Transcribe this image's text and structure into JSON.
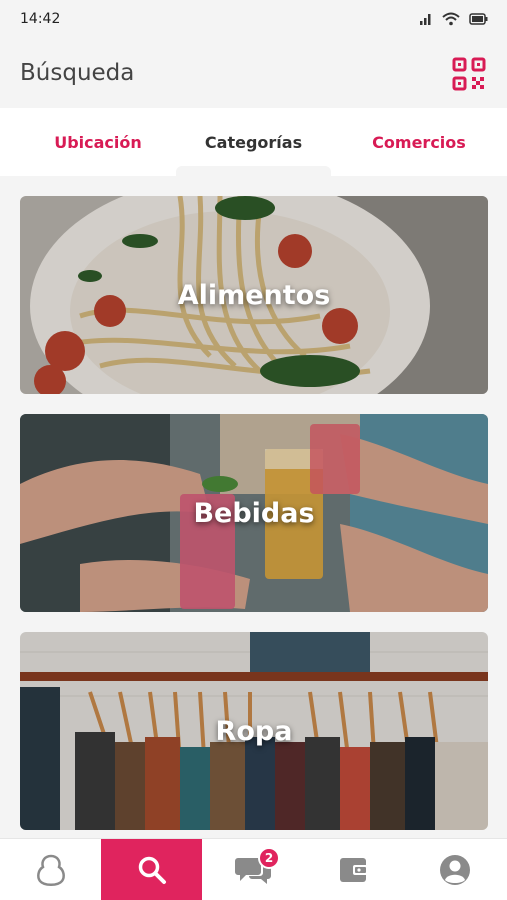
{
  "status_bar": {
    "time": "14:42"
  },
  "header": {
    "title": "Búsqueda",
    "qr_icon": "qr-code-icon"
  },
  "tabs": [
    {
      "label": "Ubicación",
      "active": false
    },
    {
      "label": "Categorías",
      "active": true
    },
    {
      "label": "Comercios",
      "active": false
    }
  ],
  "categories": [
    {
      "label": "Alimentos",
      "image": "pasta-dish-photo"
    },
    {
      "label": "Bebidas",
      "image": "drinks-toast-photo"
    },
    {
      "label": "Ropa",
      "image": "clothes-rack-photo"
    }
  ],
  "bottom_nav": {
    "items": [
      {
        "icon": "home-logo-icon"
      },
      {
        "icon": "search-icon",
        "active": true
      },
      {
        "icon": "chat-icon",
        "badge": "2"
      },
      {
        "icon": "wallet-icon"
      },
      {
        "icon": "account-icon"
      }
    ]
  },
  "colors": {
    "accent": "#e0245e",
    "tab_accent": "#d81b55",
    "background": "#f4f4f4"
  }
}
